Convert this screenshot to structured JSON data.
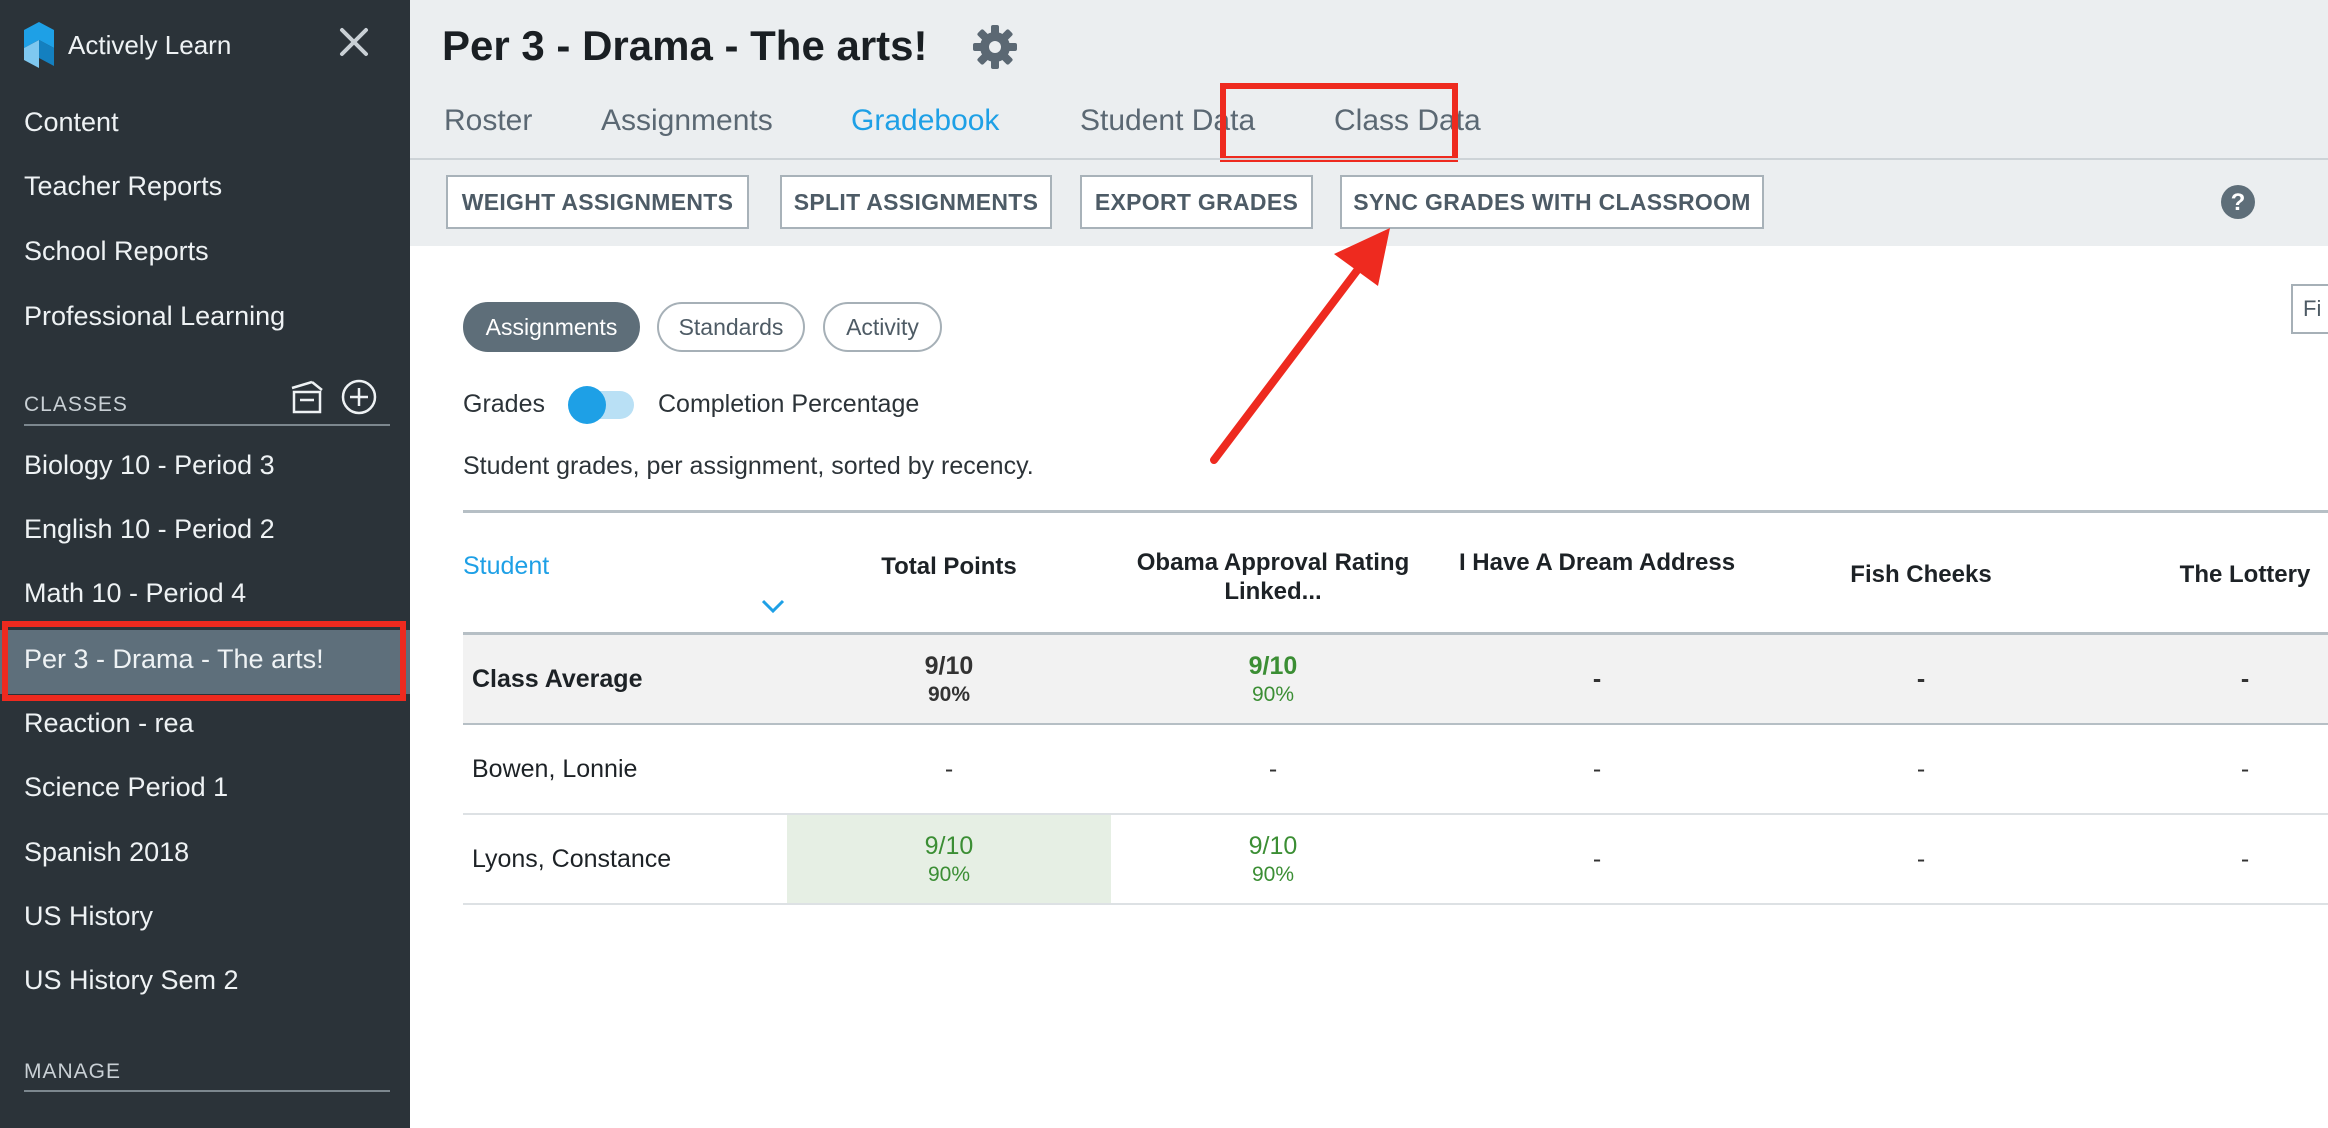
{
  "sidebar": {
    "brand_name": "Actively Learn",
    "nav": [
      "Content",
      "Teacher Reports",
      "School Reports",
      "Professional Learning"
    ],
    "classes_heading": "CLASSES",
    "classes": [
      "Biology 10 - Period 3",
      "English 10 - Period 2",
      "Math 10 - Period 4",
      "Per 3 - Drama - The arts!",
      "Reaction - rea",
      "Science Period 1",
      "Spanish 2018",
      "US History",
      "US History Sem 2"
    ],
    "active_class": "Per 3 - Drama - The arts!",
    "manage_heading": "MANAGE"
  },
  "header": {
    "title": "Per 3 - Drama - The arts!",
    "tabs": [
      "Roster",
      "Assignments",
      "Gradebook",
      "Student Data",
      "Class Data"
    ],
    "active_tab": "Gradebook",
    "tools": [
      "WEIGHT ASSIGNMENTS",
      "SPLIT ASSIGNMENTS",
      "EXPORT GRADES",
      "SYNC GRADES WITH CLASSROOM"
    ],
    "help_symbol": "?"
  },
  "main": {
    "views": [
      "Assignments",
      "Standards",
      "Activity"
    ],
    "active_view": "Assignments",
    "partial_button": "Fi",
    "toggle_left": "Grades",
    "toggle_right": "Completion Percentage",
    "description": "Student grades, per assignment, sorted by recency."
  },
  "table": {
    "student_header": "Student",
    "columns": [
      "Total Points",
      "Obama Approval Rating Linked...",
      "I Have A Dream Address",
      "Fish Cheeks",
      "The Lottery"
    ],
    "average": {
      "label": "Class Average",
      "cells": [
        {
          "score": "9/10",
          "pct": "90%"
        },
        {
          "score": "9/10",
          "pct": "90%"
        },
        {
          "score": "-",
          "pct": ""
        },
        {
          "score": "-",
          "pct": ""
        },
        {
          "score": "-",
          "pct": ""
        }
      ]
    },
    "rows": [
      {
        "name": "Bowen, Lonnie",
        "cells": [
          {
            "score": "-",
            "pct": ""
          },
          {
            "score": "-",
            "pct": ""
          },
          {
            "score": "-",
            "pct": ""
          },
          {
            "score": "-",
            "pct": ""
          },
          {
            "score": "-",
            "pct": ""
          }
        ]
      },
      {
        "name": "Lyons, Constance",
        "cells": [
          {
            "score": "9/10",
            "pct": "90%"
          },
          {
            "score": "9/10",
            "pct": "90%"
          },
          {
            "score": "-",
            "pct": ""
          },
          {
            "score": "-",
            "pct": ""
          },
          {
            "score": "-",
            "pct": ""
          }
        ]
      }
    ]
  },
  "colors": {
    "sidebar_bg": "#2b3339",
    "accent": "#1ea0e6",
    "highlight": "#ee2a1f",
    "grade_green": "#3b8e34"
  },
  "icons": [
    "actively-learn-logo",
    "close-icon",
    "archive-icon",
    "add-circle-icon",
    "gear-icon",
    "help-icon",
    "chevron-down-icon"
  ]
}
